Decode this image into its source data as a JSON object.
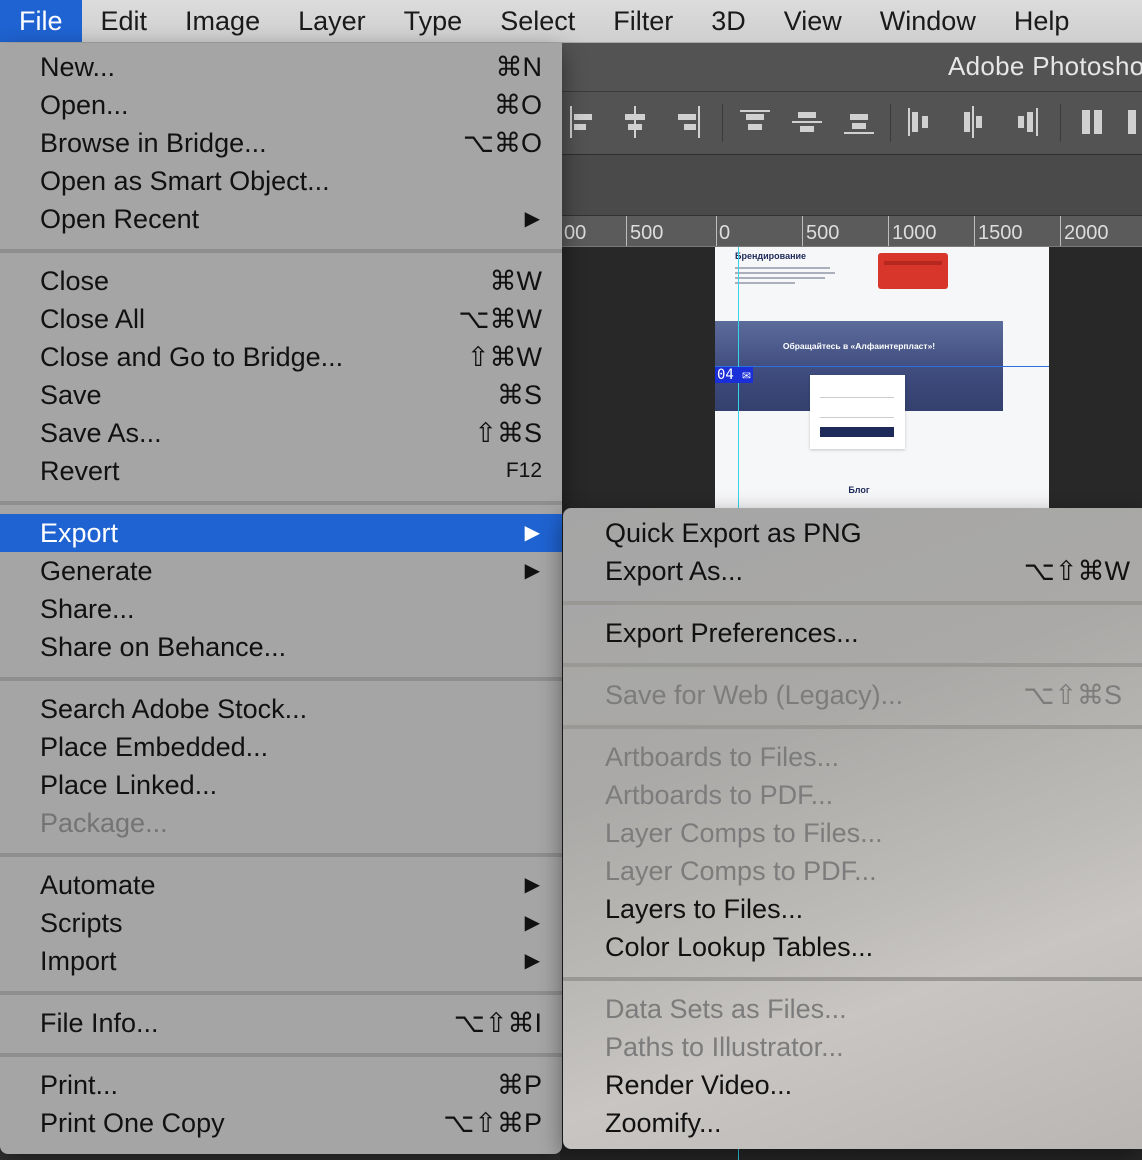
{
  "menubar": {
    "items": [
      {
        "label": "File",
        "active": true
      },
      {
        "label": "Edit"
      },
      {
        "label": "Image"
      },
      {
        "label": "Layer"
      },
      {
        "label": "Type"
      },
      {
        "label": "Select"
      },
      {
        "label": "Filter"
      },
      {
        "label": "3D"
      },
      {
        "label": "View"
      },
      {
        "label": "Window"
      },
      {
        "label": "Help"
      }
    ]
  },
  "app": {
    "title": "Adobe Photosho",
    "ruler_labels": [
      "00",
      "500",
      "0",
      "500",
      "1000",
      "1500",
      "2000"
    ]
  },
  "artboard": {
    "heading": "Брендирование",
    "banner_title": "Обращайтесь в «Алфаинтерпласт»!",
    "selection_tag": "04",
    "blog_label": "Блог"
  },
  "file_menu": {
    "items": [
      {
        "label": "New...",
        "shortcut": "⌘N"
      },
      {
        "label": "Open...",
        "shortcut": "⌘O"
      },
      {
        "label": "Browse in Bridge...",
        "shortcut": "⌥⌘O"
      },
      {
        "label": "Open as Smart Object...",
        "shortcut": ""
      },
      {
        "label": "Open Recent",
        "submenu": true
      },
      {
        "label": "Close",
        "shortcut": "⌘W"
      },
      {
        "label": "Close All",
        "shortcut": "⌥⌘W"
      },
      {
        "label": "Close and Go to Bridge...",
        "shortcut": "⇧⌘W"
      },
      {
        "label": "Save",
        "shortcut": "⌘S"
      },
      {
        "label": "Save As...",
        "shortcut": "⇧⌘S"
      },
      {
        "label": "Revert",
        "shortcut": "F12"
      },
      {
        "label": "Export",
        "submenu": true,
        "highlighted": true
      },
      {
        "label": "Generate",
        "submenu": true
      },
      {
        "label": "Share...",
        "shortcut": ""
      },
      {
        "label": "Share on Behance...",
        "shortcut": ""
      },
      {
        "label": "Search Adobe Stock...",
        "shortcut": ""
      },
      {
        "label": "Place Embedded...",
        "shortcut": ""
      },
      {
        "label": "Place Linked...",
        "shortcut": ""
      },
      {
        "label": "Package...",
        "disabled": true
      },
      {
        "label": "Automate",
        "submenu": true
      },
      {
        "label": "Scripts",
        "submenu": true
      },
      {
        "label": "Import",
        "submenu": true
      },
      {
        "label": "File Info...",
        "shortcut": "⌥⇧⌘I"
      },
      {
        "label": "Print...",
        "shortcut": "⌘P"
      },
      {
        "label": "Print One Copy",
        "shortcut": "⌥⇧⌘P"
      }
    ]
  },
  "export_submenu": {
    "items": [
      {
        "label": "Quick Export as PNG",
        "shortcut": ""
      },
      {
        "label": "Export As...",
        "shortcut": "⌥⇧⌘W"
      },
      {
        "label": "Export Preferences...",
        "shortcut": ""
      },
      {
        "label": "Save for Web (Legacy)...",
        "shortcut": "⌥⇧⌘S",
        "disabled": true
      },
      {
        "label": "Artboards to Files...",
        "disabled": true
      },
      {
        "label": "Artboards to PDF...",
        "disabled": true
      },
      {
        "label": "Layer Comps to Files...",
        "disabled": true
      },
      {
        "label": "Layer Comps to PDF...",
        "disabled": true
      },
      {
        "label": "Layers to Files...",
        "shortcut": ""
      },
      {
        "label": "Color Lookup Tables...",
        "shortcut": ""
      },
      {
        "label": "Data Sets as Files...",
        "disabled": true
      },
      {
        "label": "Paths to Illustrator...",
        "disabled": true
      },
      {
        "label": "Render Video...",
        "shortcut": ""
      },
      {
        "label": "Zoomify...",
        "shortcut": ""
      }
    ]
  },
  "icons": {
    "submenu_arrow": "▶"
  },
  "colors": {
    "highlight": "#1f63d2",
    "menu_bg": "#a9a9a9",
    "disabled_text": "#747474"
  }
}
